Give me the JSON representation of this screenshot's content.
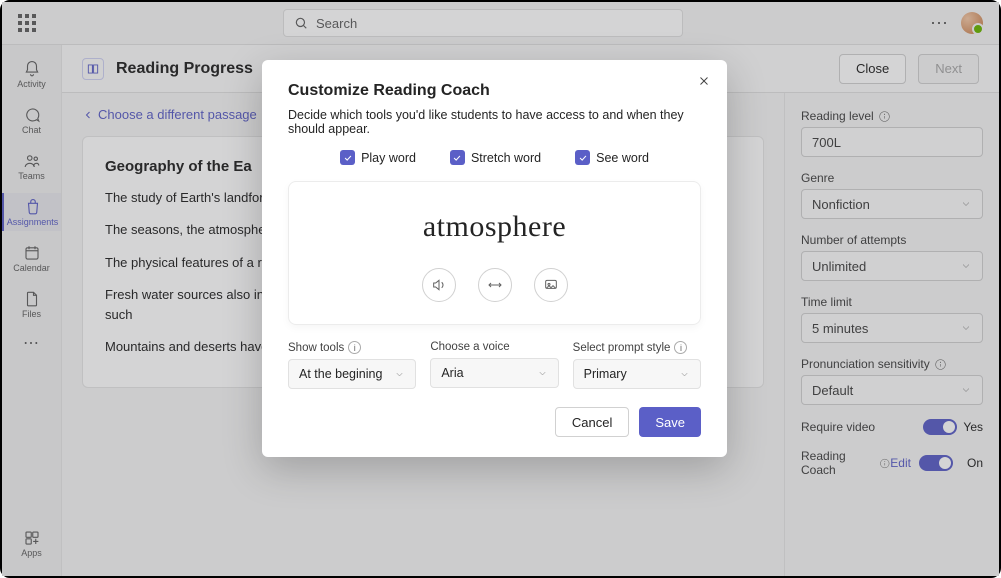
{
  "search": {
    "placeholder": "Search"
  },
  "rail": {
    "items": [
      {
        "label": "Activity",
        "icon": "bell"
      },
      {
        "label": "Chat",
        "icon": "chat"
      },
      {
        "label": "Teams",
        "icon": "teams"
      },
      {
        "label": "Assignments",
        "icon": "bag",
        "selected": true
      },
      {
        "label": "Calendar",
        "icon": "calendar"
      },
      {
        "label": "Files",
        "icon": "file"
      }
    ],
    "apps_label": "Apps"
  },
  "header": {
    "title": "Reading Progress",
    "close_label": "Close",
    "next_label": "Next"
  },
  "backlink": "Choose a different passage",
  "passage": {
    "title": "Geography of the Ea",
    "paragraphs": [
      "The study of Earth's landforms glaciers, lakes, or rivers. Land physical geography of Earth  ge",
      "The seasons, the atmosphere combination of factors that",
      "The physical features of a r settlement areas. In the U.S",
      "Fresh water sources also inf history, people have settled There was an added bonus, popular water sources, such",
      "Mountains and deserts have their own."
    ]
  },
  "side": {
    "reading_level": {
      "label": "Reading level",
      "value": "700L"
    },
    "genre": {
      "label": "Genre",
      "value": "Nonfiction"
    },
    "attempts": {
      "label": "Number of attempts",
      "value": "Unlimited"
    },
    "time_limit": {
      "label": "Time limit",
      "value": "5 minutes"
    },
    "pron_sens": {
      "label": "Pronunciation sensitivity",
      "value": "Default"
    },
    "require_video": {
      "label": "Require video",
      "value": "Yes"
    },
    "reading_coach": {
      "label": "Reading Coach",
      "edit": "Edit",
      "value": "On"
    }
  },
  "modal": {
    "title": "Customize Reading Coach",
    "subtitle": "Decide which tools you'd like students to have access to and when they should appear.",
    "checkboxes": [
      {
        "label": "Play word",
        "checked": true
      },
      {
        "label": "Stretch word",
        "checked": true
      },
      {
        "label": "See word",
        "checked": true
      }
    ],
    "preview_word": "atmosphere",
    "selects": [
      {
        "label": "Show tools",
        "value": "At the begining",
        "info": true
      },
      {
        "label": "Choose a voice",
        "value": "Aria",
        "info": false
      },
      {
        "label": "Select prompt style",
        "value": "Primary",
        "info": true
      }
    ],
    "cancel": "Cancel",
    "save": "Save"
  }
}
